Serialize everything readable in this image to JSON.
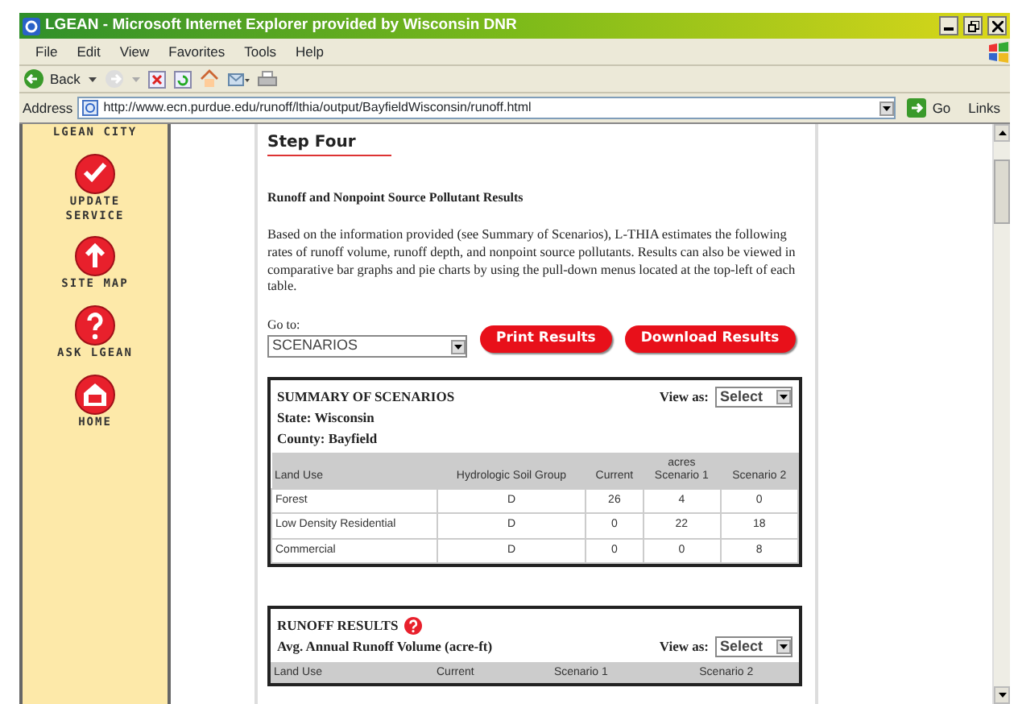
{
  "window": {
    "title": "LGEAN - Microsoft Internet Explorer provided by Wisconsin DNR"
  },
  "menu": [
    "File",
    "Edit",
    "View",
    "Favorites",
    "Tools",
    "Help"
  ],
  "toolbar": {
    "back_label": "Back"
  },
  "address": {
    "label": "Address",
    "url": "http://www.ecn.purdue.edu/runoff/lthia/output/BayfieldWisconsin/runoff.html",
    "go": "Go",
    "links": "Links"
  },
  "sidebar": {
    "header": "LGEAN CITY",
    "items": [
      {
        "kind": "check",
        "label": "UPDATE SERVICE"
      },
      {
        "kind": "up",
        "label": "SITE MAP"
      },
      {
        "kind": "question",
        "label": "ASK LGEAN"
      },
      {
        "kind": "home",
        "label": "HOME"
      }
    ]
  },
  "main": {
    "heading": "Step Four",
    "subheading": "Runoff and Nonpoint Source Pollutant Results",
    "intro": "Based on the information provided (see Summary of Scenarios), L-THIA estimates the following rates of runoff volume, runoff depth, and nonpoint source pollutants. Results can also be viewed in comparative bar graphs and pie charts by using the pull-down menus located at the top-left of each table.",
    "goto": {
      "label": "Go to:",
      "value": "SCENARIOS"
    },
    "buttons": [
      "Print Results",
      "Download Results"
    ],
    "tables": [
      {
        "title": "SUMMARY OF SCENARIOS",
        "help": false,
        "subtitles": [
          "State: Wisconsin",
          "County: Bayfield"
        ],
        "view_label": "View as:",
        "view_value": "Select",
        "columns": [
          {
            "label": "Land Use"
          },
          {
            "label": "Hydrologic Soil Group"
          },
          {
            "label": "Current"
          },
          {
            "label": "Scenario 1",
            "group": "acres"
          },
          {
            "label": "Scenario 2"
          }
        ],
        "rows": [
          [
            "Forest",
            "D",
            "26",
            "4",
            "0"
          ],
          [
            "Low Density Residential",
            "D",
            "0",
            "22",
            "18"
          ],
          [
            "Commercial",
            "D",
            "0",
            "0",
            "8"
          ]
        ]
      },
      {
        "title": "RUNOFF RESULTS",
        "help": true,
        "subtitles": [
          "Avg. Annual Runoff Volume (acre-ft)"
        ],
        "view_label": "View as:",
        "view_value": "Select",
        "columns": [
          {
            "label": "Land Use"
          },
          {
            "label": "Current"
          },
          {
            "label": "Scenario 1"
          },
          {
            "label": "Scenario 2"
          }
        ]
      }
    ]
  }
}
